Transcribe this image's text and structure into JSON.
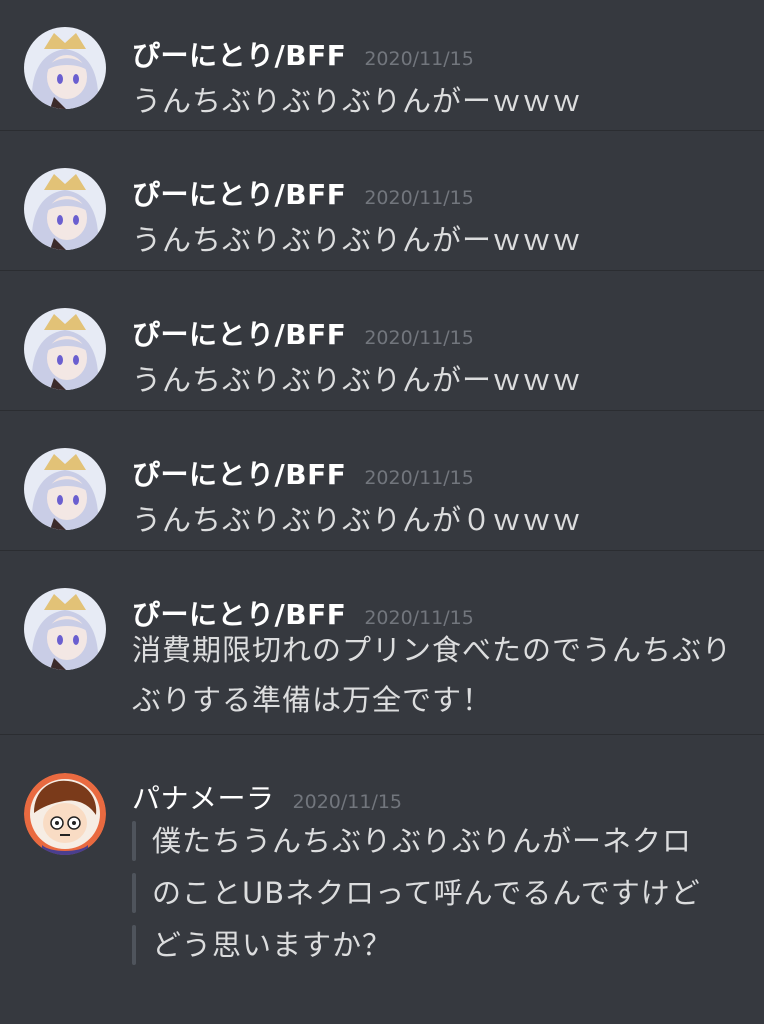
{
  "messages": [
    {
      "author": "ぴーにとり/BFF",
      "timestamp": "2020/11/15",
      "text": "うんちぶりぶりぶりんがーｗｗｗ"
    },
    {
      "author": "ぴーにとり/BFF",
      "timestamp": "2020/11/15",
      "text": "うんちぶりぶりぶりんがーｗｗｗ"
    },
    {
      "author": "ぴーにとり/BFF",
      "timestamp": "2020/11/15",
      "text": "うんちぶりぶりぶりんがーｗｗｗ"
    },
    {
      "author": "ぴーにとり/BFF",
      "timestamp": "2020/11/15",
      "text": "うんちぶりぶりぶりんが０ｗｗｗ"
    },
    {
      "author": "ぴーにとり/BFF",
      "timestamp": "2020/11/15",
      "text": "消費期限切れのプリン食べたのでうんちぶりぶりする準備は万全です！"
    },
    {
      "author": "パナメーラ",
      "timestamp": "2020/11/15",
      "quote_lines": [
        "僕たちうんちぶりぶりぶりんがーネクロ",
        "のことUBネクロって呼んでるんですけど",
        "どう思いますか？"
      ]
    }
  ],
  "avatars": {
    "hair_color": "#c9cde6",
    "crown_color": "#e2c277",
    "eye_color": "#6a5fd0",
    "bg_color": "#e7ebf5",
    "alt_hair_color": "#7a3a1a",
    "alt_ring_color": "#e96a40"
  }
}
